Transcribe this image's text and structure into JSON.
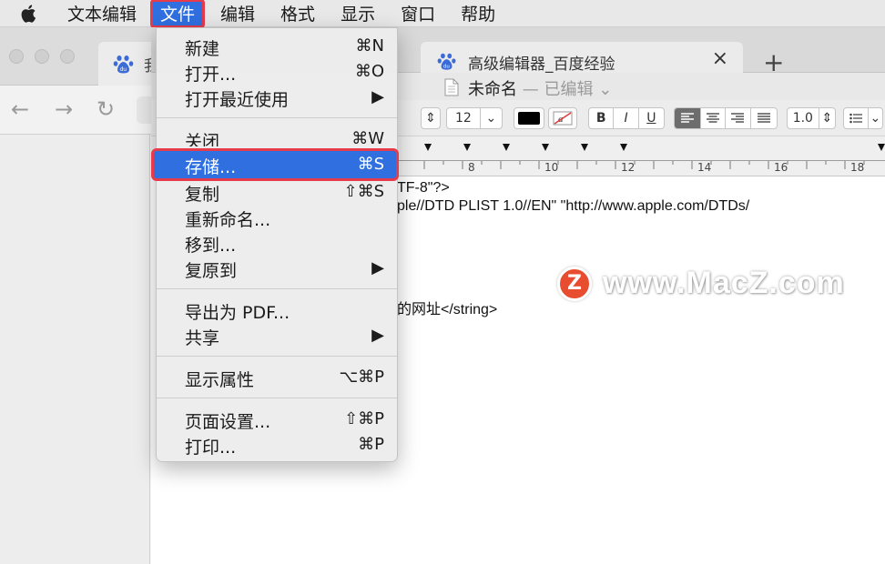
{
  "menubar": {
    "items": [
      "文本编辑",
      "文件",
      "编辑",
      "格式",
      "显示",
      "窗口",
      "帮助"
    ]
  },
  "browser": {
    "tab_label": "我"
  },
  "textedit": {
    "tab_label": "高级编辑器_百度经验",
    "tab_close": "×",
    "new_tab": "+",
    "doc_name": "未命名",
    "doc_status": "— 已编辑",
    "font_size": "12",
    "line_spacing": "1.0",
    "bold": "B",
    "italic": "I",
    "underline": "U",
    "ruler_numbers": [
      "8",
      "10",
      "12",
      "14",
      "16",
      "18"
    ],
    "lines": [
      "TF-8\"?>",
      "ple//DTD PLIST 1.0//EN\" \"http://www.apple.com/DTDs/",
      "的网址</string>"
    ]
  },
  "watermark": {
    "badge": "Z",
    "text": "www.MacZ.com"
  },
  "file_menu": {
    "items": [
      {
        "label": "新建",
        "shortcut": "⌘N"
      },
      {
        "label": "打开...",
        "shortcut": "⌘O"
      },
      {
        "label": "打开最近使用",
        "shortcut": "▶"
      },
      {
        "label": "关闭",
        "shortcut": "⌘W"
      },
      {
        "label": "存储...",
        "shortcut": "⌘S"
      },
      {
        "label": "复制",
        "shortcut": "⇧⌘S"
      },
      {
        "label": "重新命名...",
        "shortcut": ""
      },
      {
        "label": "移到...",
        "shortcut": ""
      },
      {
        "label": "复原到",
        "shortcut": "▶"
      },
      {
        "label": "导出为 PDF...",
        "shortcut": ""
      },
      {
        "label": "共享",
        "shortcut": "▶"
      },
      {
        "label": "显示属性",
        "shortcut": "⌥⌘P"
      },
      {
        "label": "页面设置...",
        "shortcut": "⇧⌘P"
      },
      {
        "label": "打印...",
        "shortcut": "⌘P"
      }
    ],
    "highlighted": "存储..."
  },
  "colors": {
    "menu_highlight": "#2f6fe0",
    "annotation_red": "#e53b4b",
    "watermark_badge": "#e84d2f"
  }
}
